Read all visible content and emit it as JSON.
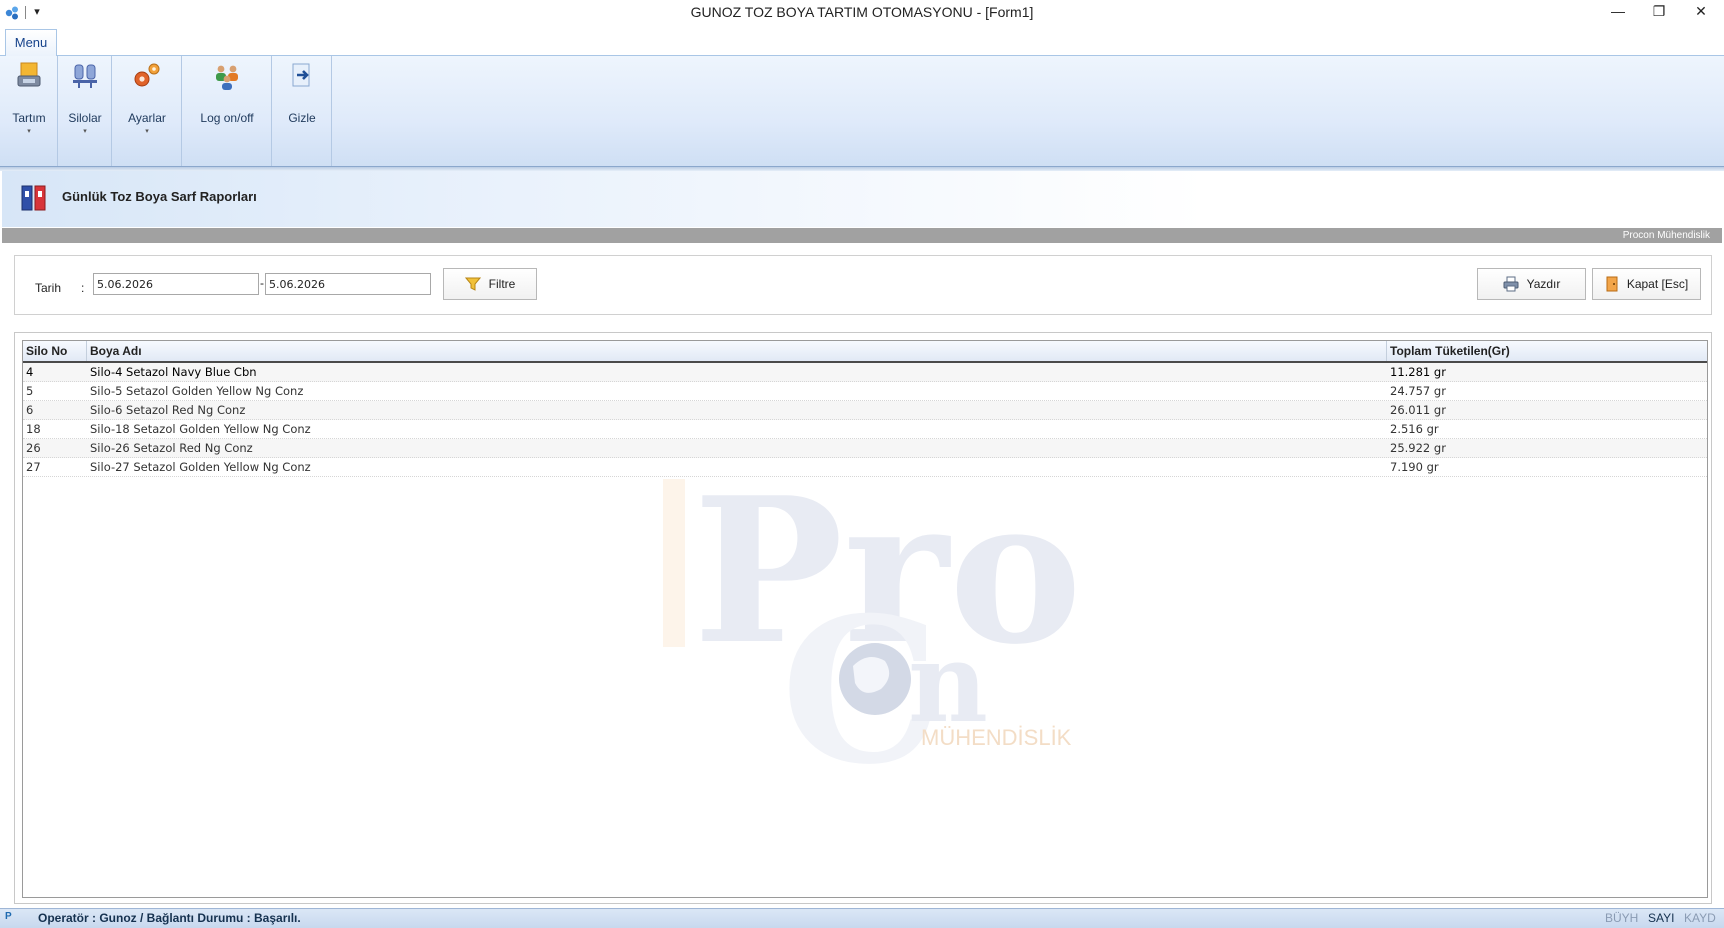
{
  "window": {
    "title": "GUNOZ TOZ BOYA TARTIM OTOMASYONU - [Form1]",
    "minimize_glyph": "—",
    "restore_glyph": "❐",
    "close_glyph": "✕",
    "quick_access_glyph": "▾"
  },
  "ribbon": {
    "tab": "Menu",
    "buttons": [
      {
        "label": "Tartım",
        "icon": "scale-box-icon",
        "has_dropdown": true
      },
      {
        "label": "Silolar",
        "icon": "silo-icon",
        "has_dropdown": true
      },
      {
        "label": "Ayarlar",
        "icon": "gears-icon",
        "has_dropdown": true
      },
      {
        "label": "Log on/off",
        "icon": "users-icon",
        "has_dropdown": false
      },
      {
        "label": "Gizle",
        "icon": "hide-arrow-icon",
        "has_dropdown": false
      }
    ],
    "dropdown_glyph": "▾"
  },
  "header": {
    "title": "Günlük Toz Boya Sarf Raporları",
    "brand": "Procon Mühendislik"
  },
  "filter": {
    "date_label": "Tarih",
    "colon": ":",
    "date_from": "5.06.2026",
    "separator": "-",
    "date_to": "5.06.2026",
    "filter_button": "Filtre",
    "print_button": "Yazdır",
    "close_button": "Kapat [Esc]"
  },
  "grid": {
    "columns": [
      "Silo No",
      "Boya Adı",
      "Toplam Tüketilen(Gr)"
    ],
    "rows": [
      {
        "silo_no": "4",
        "boya_adi": "Silo-4 Setazol Navy Blue Cbn",
        "toplam": "11.281 gr"
      },
      {
        "silo_no": "5",
        "boya_adi": "Silo-5 Setazol Golden Yellow Ng Conz",
        "toplam": "24.757 gr"
      },
      {
        "silo_no": "6",
        "boya_adi": "Silo-6 Setazol Red Ng Conz",
        "toplam": "26.011 gr"
      },
      {
        "silo_no": "18",
        "boya_adi": "Silo-18 Setazol Golden Yellow Ng Conz",
        "toplam": "2.516 gr"
      },
      {
        "silo_no": "26",
        "boya_adi": "Silo-26 Setazol Red Ng Conz",
        "toplam": "25.922 gr"
      },
      {
        "silo_no": "27",
        "boya_adi": "Silo-27 Setazol Golden Yellow Ng Conz",
        "toplam": "7.190 gr"
      }
    ],
    "selected_row": 0
  },
  "watermark": {
    "text_pro": "Pro",
    "text_c": "C",
    "text_n": "n",
    "text_sub": "MÜHENDİSLİK"
  },
  "status": {
    "app_icon_label": "P",
    "operator_text": "Operatör :  Gunoz / Bağlantı Durumu :  Başarılı.",
    "keys": [
      {
        "label": "BÜYH",
        "active": false
      },
      {
        "label": "SAYI",
        "active": true
      },
      {
        "label": "KAYD",
        "active": false
      }
    ]
  },
  "colors": {
    "accent": "#15428b",
    "ribbon_bg": "#dfeafa",
    "watermark": "#e8ebf3",
    "key_inactive": "#8a9bb3",
    "key_active": "#15314f"
  }
}
